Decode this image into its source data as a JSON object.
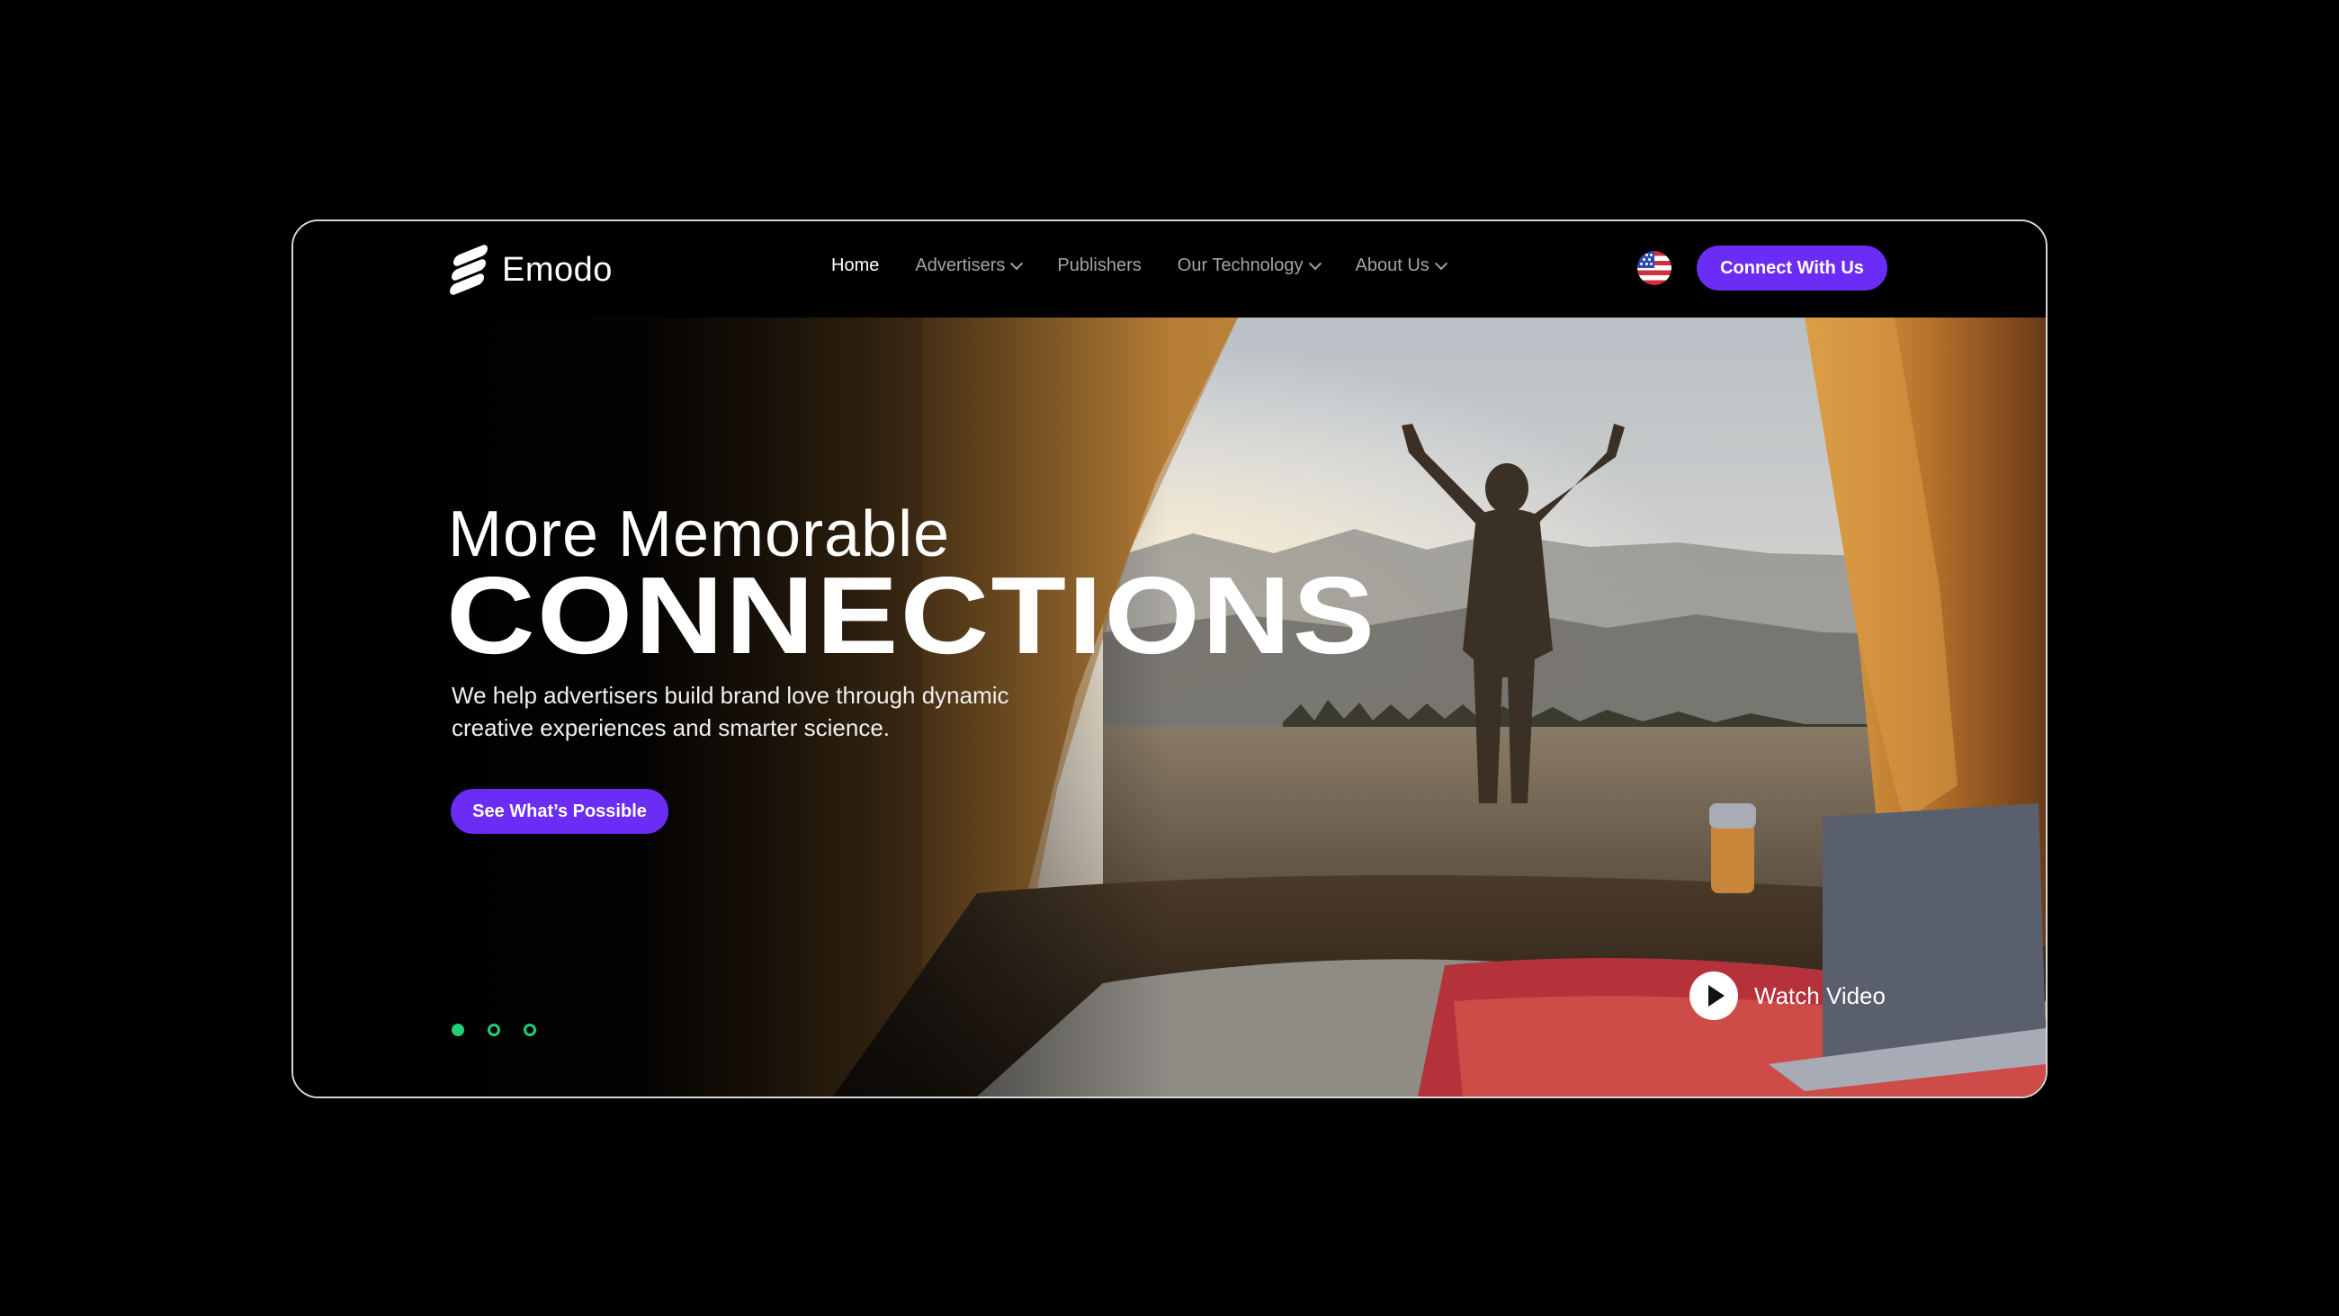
{
  "brand": {
    "name": "Emodo"
  },
  "nav": {
    "items": [
      {
        "label": "Home",
        "active": true,
        "has_dropdown": false
      },
      {
        "label": "Advertisers",
        "active": false,
        "has_dropdown": true
      },
      {
        "label": "Publishers",
        "active": false,
        "has_dropdown": false
      },
      {
        "label": "Our Technology",
        "active": false,
        "has_dropdown": true
      },
      {
        "label": "About Us",
        "active": false,
        "has_dropdown": true
      }
    ],
    "language_icon": "us-flag-icon",
    "cta_label": "Connect With Us"
  },
  "hero": {
    "headline_top": "More Memorable",
    "headline_main": "CONNECTIONS",
    "subtext": "We help advertisers build brand love through dynamic creative experiences and smarter science.",
    "button_label": "See What’s Possible",
    "watch_label": "Watch Video",
    "slides_total": 3,
    "slide_active": 1
  },
  "colors": {
    "accent": "#6b2cf5",
    "indicator": "#1fd07a",
    "background": "#000000"
  }
}
